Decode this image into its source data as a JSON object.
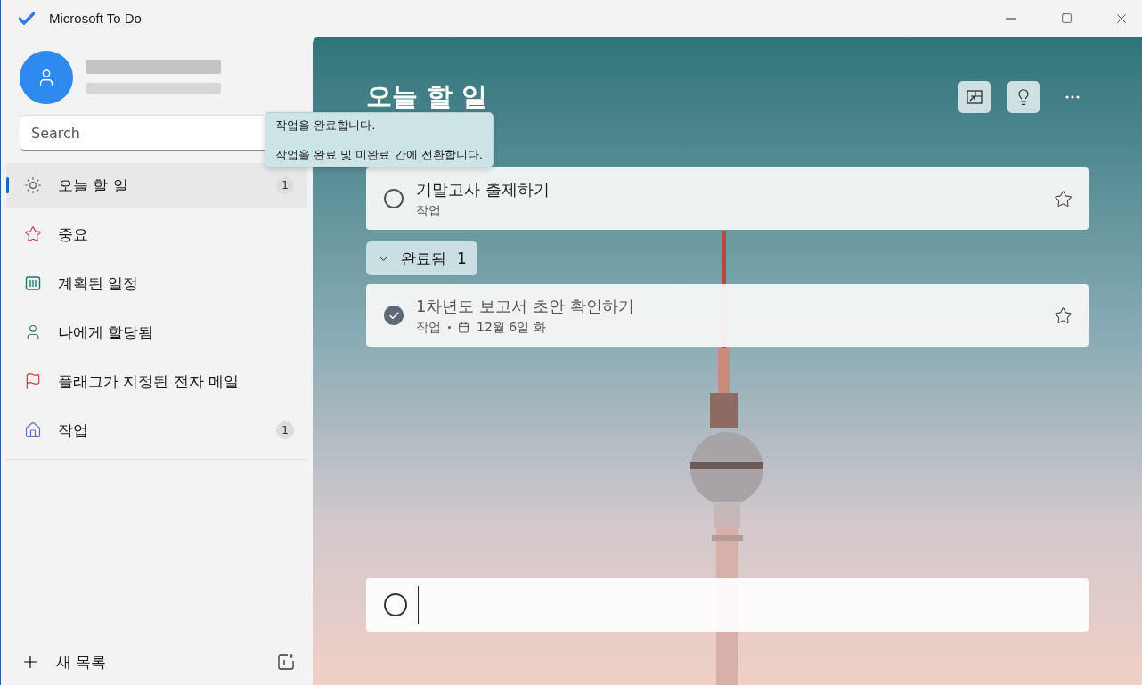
{
  "window": {
    "title": "Microsoft To Do"
  },
  "sidebar": {
    "search": {
      "placeholder": "Search"
    },
    "items": [
      {
        "kind": "sun",
        "label": "오늘 할 일",
        "count": "1",
        "selected": true
      },
      {
        "kind": "star",
        "label": "중요",
        "selected": false
      },
      {
        "kind": "planned",
        "label": "계획된 일정",
        "selected": false
      },
      {
        "kind": "person",
        "label": "나에게 할당됨",
        "selected": false
      },
      {
        "kind": "flag",
        "label": "플래그가 지정된 전자 메일",
        "selected": false
      },
      {
        "kind": "home",
        "label": "작업",
        "count": "1",
        "selected": false
      }
    ],
    "new_list": "새 목록"
  },
  "main": {
    "title": "오늘 할 일",
    "tooltip": [
      "작업을 완료합니다.",
      "작업을 완료 및 미완료 간에 전환합니다."
    ],
    "tasks": [
      {
        "title": "기말고사 출제하기",
        "list": "작업",
        "completed": false,
        "important": false
      }
    ],
    "completed_group": {
      "label": "완료됨",
      "count": "1",
      "expanded": true
    },
    "completed_tasks": [
      {
        "title": "1차년도 보고서 초안 확인하기",
        "list": "작업",
        "due": "12월 6일 화",
        "completed": true,
        "important": false
      }
    ]
  }
}
